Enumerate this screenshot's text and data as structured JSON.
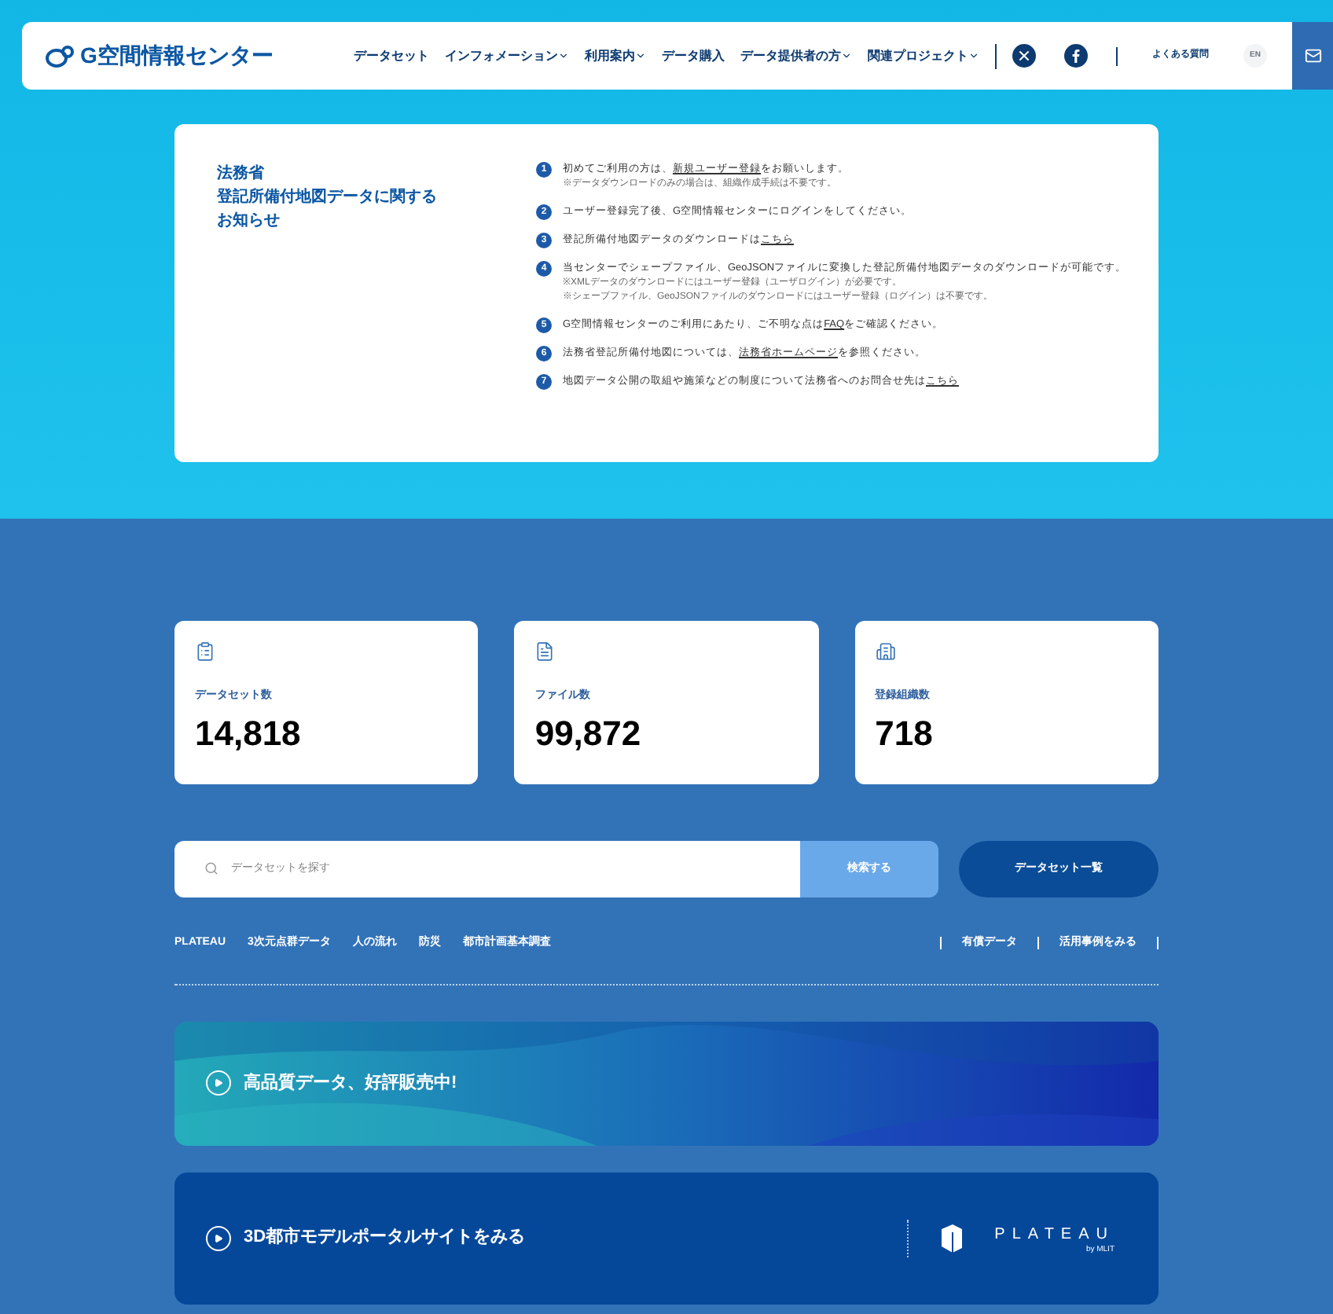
{
  "header": {
    "logo": "G空間情報センター",
    "nav": [
      {
        "label": "データセット",
        "has_menu": false
      },
      {
        "label": "インフォメーション",
        "has_menu": true
      },
      {
        "label": "利用案内",
        "has_menu": true
      },
      {
        "label": "データ購入",
        "has_menu": false
      },
      {
        "label": "データ提供者の方",
        "has_menu": true
      },
      {
        "label": "関連プロジェクト",
        "has_menu": true
      }
    ],
    "faq": "よくある質問",
    "lang": "EN"
  },
  "notice": {
    "title": [
      "法務省",
      "登記所備付地図データに関する",
      "お知らせ"
    ],
    "items": [
      {
        "number": "1",
        "parts": [
          {
            "text": "初めてご利用の方は、",
            "link": false
          },
          {
            "text": "新規ユーザー登録",
            "link": true
          },
          {
            "text": "をお願いします。",
            "link": false
          }
        ],
        "notes": [
          "※データダウンロードのみの場合は、組織作成手続は不要です。"
        ]
      },
      {
        "number": "2",
        "parts": [
          {
            "text": "ユーザー登録完了後、G空間情報センターにログインをしてください。",
            "link": false
          }
        ]
      },
      {
        "number": "3",
        "parts": [
          {
            "text": "登記所備付地図データのダウンロードは",
            "link": false
          },
          {
            "text": "こちら",
            "link": true
          }
        ]
      },
      {
        "number": "4",
        "parts": [
          {
            "text": "当センターでシェープファイル、GeoJSONファイルに変換した登記所備付地図データのダウンロードが可能です。",
            "link": false
          }
        ],
        "notes": [
          "※XMLデータのダウンロードにはユーザー登録（ユーザログイン）が必要です。",
          "※シェープファイル、GeoJSONファイルのダウンロードにはユーザー登録（ログイン）は不要です。"
        ]
      },
      {
        "number": "5",
        "parts": [
          {
            "text": "G空間情報センターのご利用にあたり、ご不明な点は",
            "link": false
          },
          {
            "text": "FAQ",
            "link": true
          },
          {
            "text": "をご確認ください。",
            "link": false
          }
        ]
      },
      {
        "number": "6",
        "parts": [
          {
            "text": "法務省登記所備付地図については、",
            "link": false
          },
          {
            "text": "法務省ホームページ",
            "link": true
          },
          {
            "text": "を参照ください。",
            "link": false
          }
        ]
      },
      {
        "number": "7",
        "parts": [
          {
            "text": "地図データ公開の取組や施策などの制度について法務省へのお問合せ先は",
            "link": false
          },
          {
            "text": "こちら",
            "link": true
          }
        ]
      }
    ]
  },
  "stats": [
    {
      "kind": "clipboard",
      "label": "データセット数",
      "value": "14,818"
    },
    {
      "kind": "file",
      "label": "ファイル数",
      "value": "99,872"
    },
    {
      "kind": "building",
      "label": "登録組織数",
      "value": "718"
    }
  ],
  "search": {
    "placeholder": "データセットを探す",
    "button": "検索する",
    "list_button": "データセット一覧"
  },
  "tags": [
    "PLATEAU",
    "3次元点群データ",
    "人の流れ",
    "防災",
    "都市計画基本調査"
  ],
  "side_links": [
    "有償データ",
    "活用事例をみる"
  ],
  "banners": [
    {
      "kind": "wave",
      "label": "高品質データ、好評販売中!"
    },
    {
      "kind": "plateau",
      "label": "3D都市モデルポータルサイトをみる",
      "logo": "PLATEAU",
      "logo_sub": "by MLIT"
    }
  ]
}
